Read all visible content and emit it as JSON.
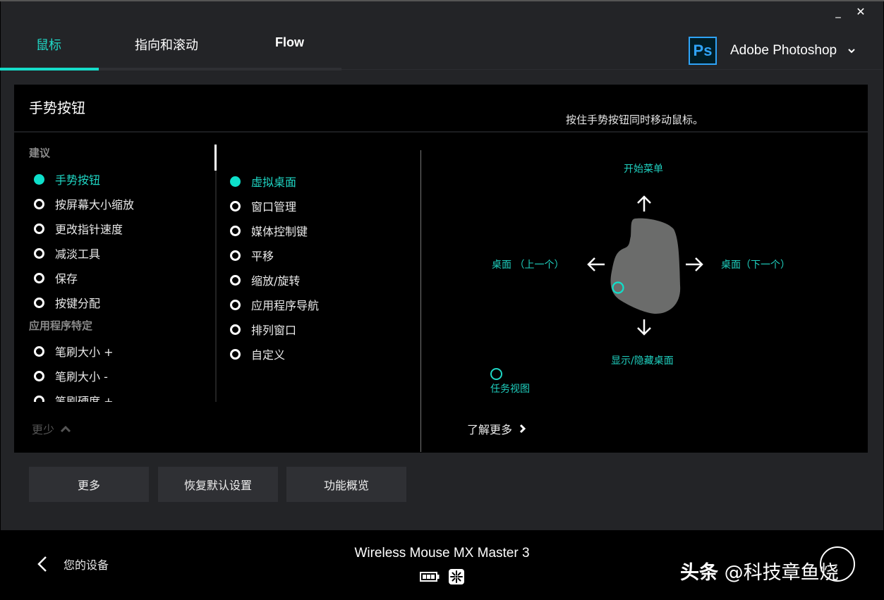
{
  "window": {
    "minimize_glyph": "_",
    "close_glyph": "✕"
  },
  "tabs": [
    {
      "label": "鼠标",
      "active": true
    },
    {
      "label": "指向和滚动",
      "active": false
    },
    {
      "label": "Flow",
      "active": false
    }
  ],
  "app_selector": {
    "icon_text": "Ps",
    "app_name": "Adobe Photoshop"
  },
  "panel": {
    "title": "手势按钮",
    "hint": "按住手势按钮同时移动鼠标。"
  },
  "left_list": {
    "sections": [
      {
        "heading": "建议",
        "items": [
          {
            "label": "手势按钮",
            "selected": true
          },
          {
            "label": "按屏幕大小缩放",
            "selected": false
          },
          {
            "label": "更改指针速度",
            "selected": false
          },
          {
            "label": "减淡工具",
            "selected": false
          },
          {
            "label": "保存",
            "selected": false
          },
          {
            "label": "按键分配",
            "selected": false
          }
        ]
      },
      {
        "heading": "应用程序特定",
        "items": [
          {
            "label": "笔刷大小 +",
            "selected": false
          },
          {
            "label": "笔刷大小 -",
            "selected": false
          },
          {
            "label": "笔刷硬度 +",
            "selected": false
          }
        ]
      }
    ],
    "less_label": "更少"
  },
  "mid_list": {
    "items": [
      {
        "label": "虚拟桌面",
        "selected": true
      },
      {
        "label": "窗口管理",
        "selected": false
      },
      {
        "label": "媒体控制键",
        "selected": false
      },
      {
        "label": "平移",
        "selected": false
      },
      {
        "label": "缩放/旋转",
        "selected": false
      },
      {
        "label": "应用程序导航",
        "selected": false
      },
      {
        "label": "排列窗口",
        "selected": false
      },
      {
        "label": "自定义",
        "selected": false
      }
    ]
  },
  "gesture_diagram": {
    "up": "开始菜单",
    "left": "桌面 （上一个）",
    "right": "桌面（下一个）",
    "down": "显示/隐藏桌面",
    "click": "任务视图",
    "learn_more": "了解更多"
  },
  "buttons": {
    "more": "更多",
    "reset": "恢复默认设置",
    "overview": "功能概览"
  },
  "footer": {
    "back_label": "您的设备",
    "device_name": "Wireless Mouse MX Master 3",
    "battery_level": "3/3",
    "watermark_brand": "头条",
    "watermark_handle": "@科技章鱼烧"
  },
  "colors": {
    "accent": "#16dcc9",
    "panel_bg": "#000000",
    "app_bg": "#232427",
    "button_bg": "#2f3034",
    "ps_blue": "#2fa3f7"
  }
}
